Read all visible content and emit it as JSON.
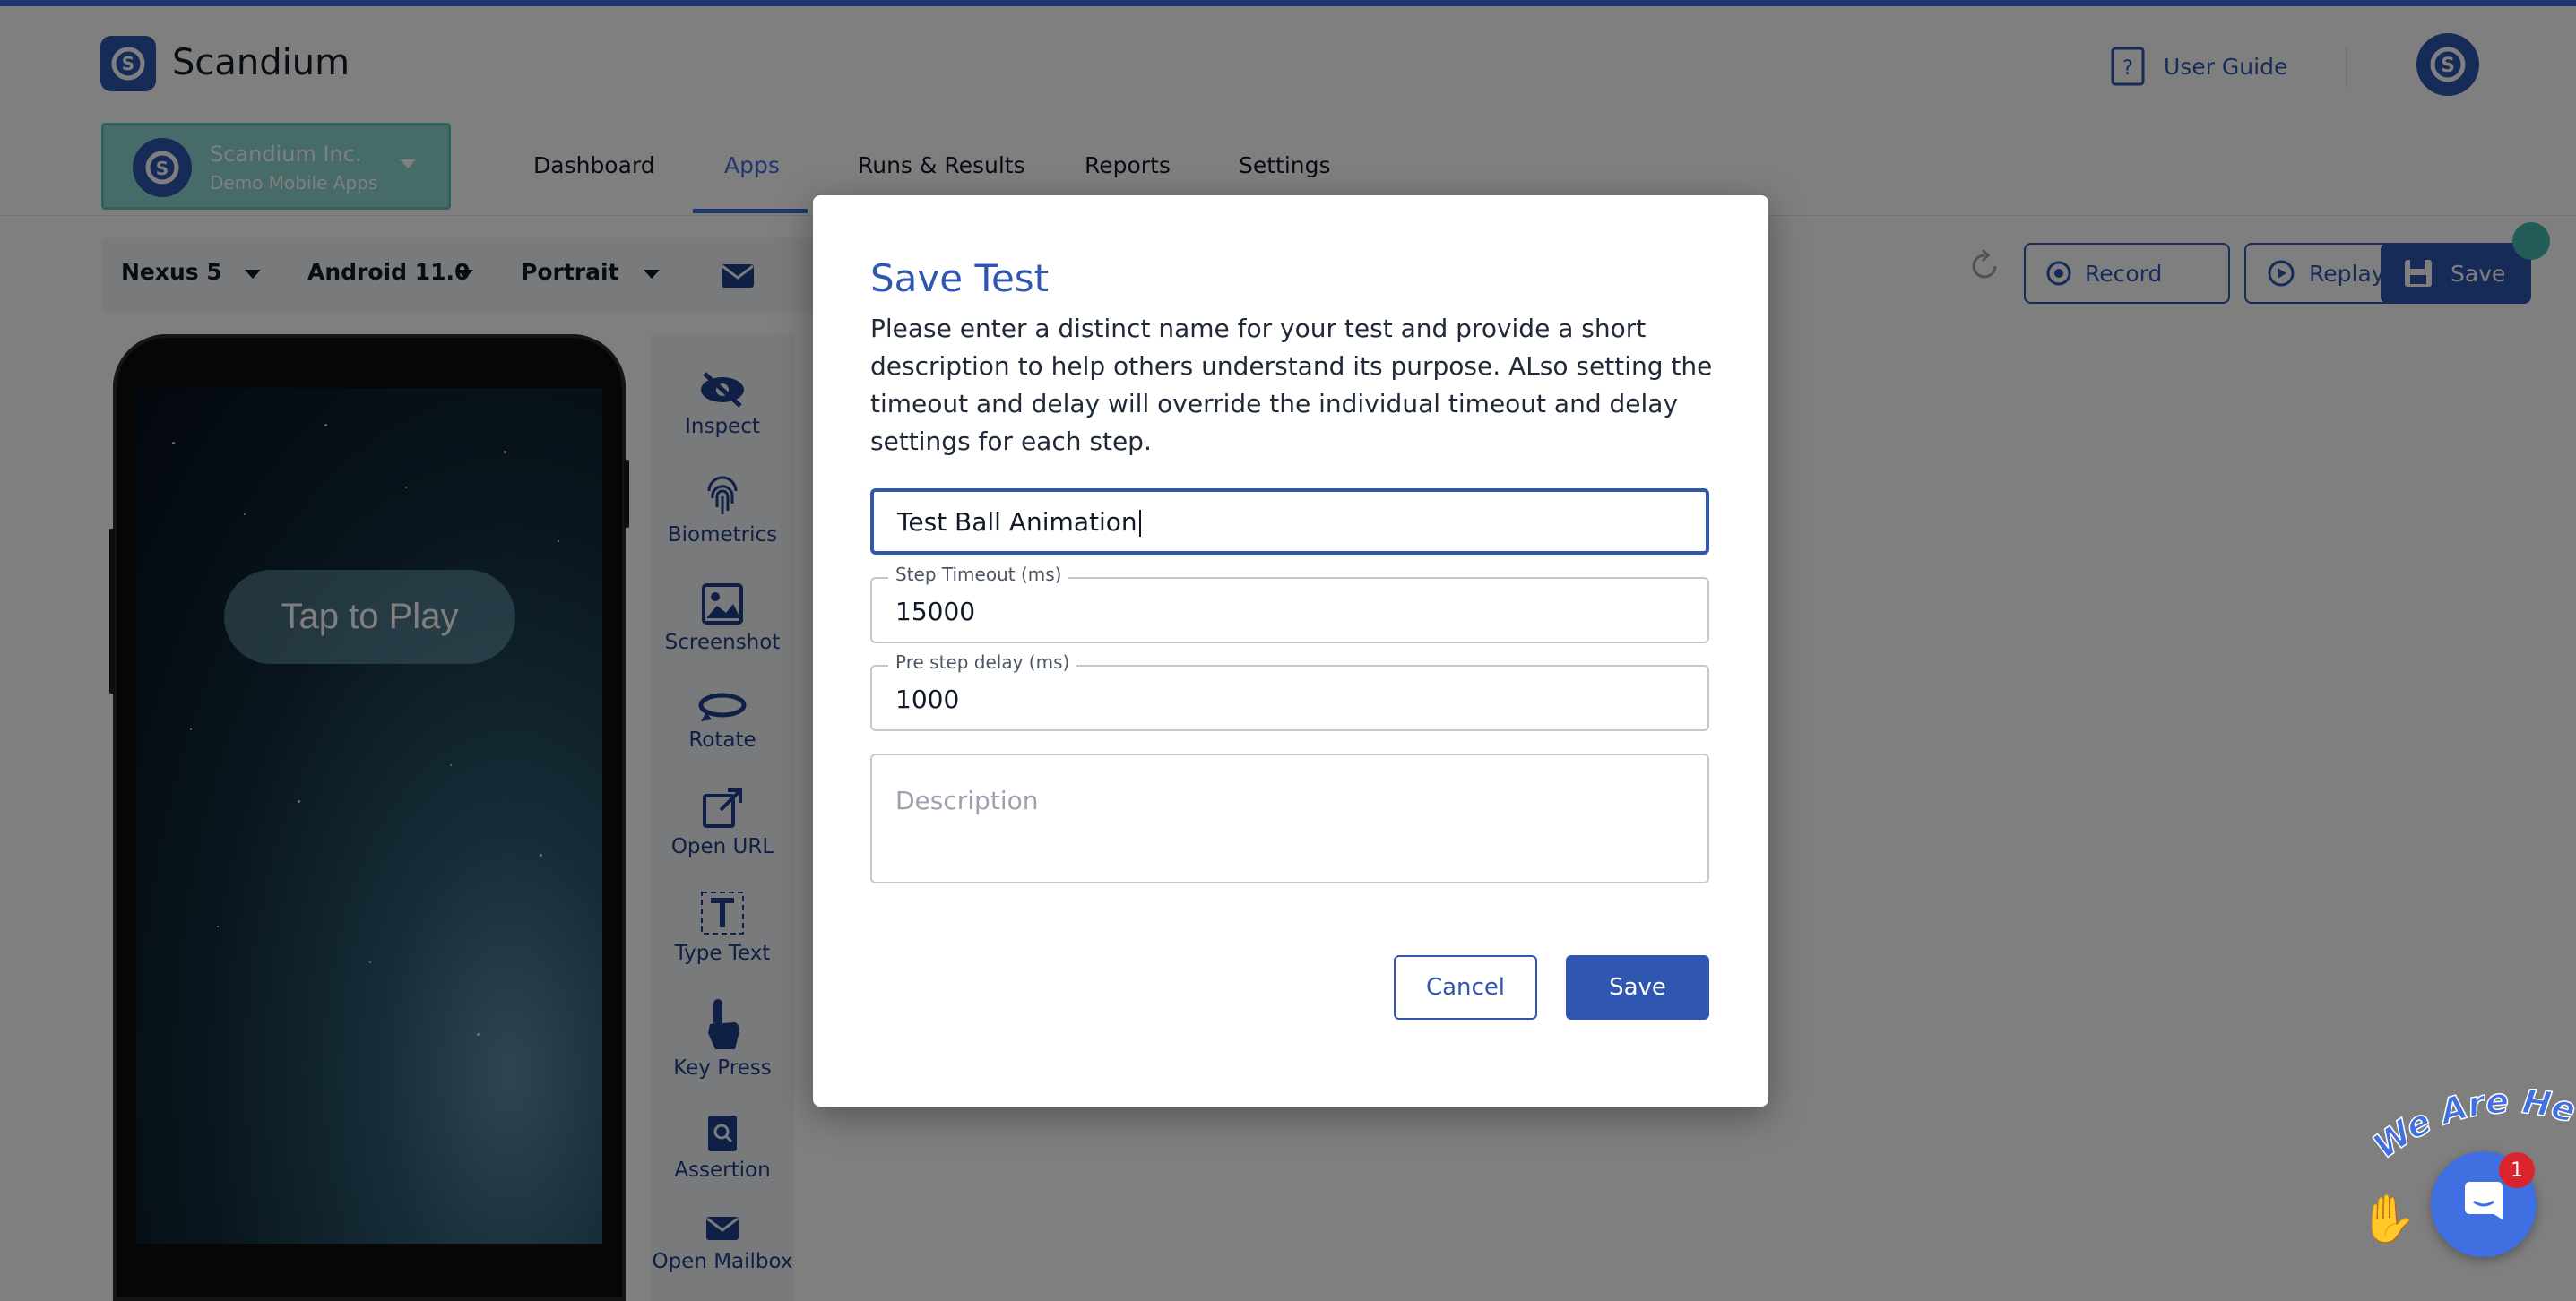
{
  "app": {
    "title": "Scandium"
  },
  "header": {
    "user_guide_label": "User Guide"
  },
  "org": {
    "name": "Scandium Inc.",
    "project": "Demo Mobile Apps"
  },
  "nav": {
    "tabs": [
      {
        "label": "Dashboard",
        "active": false
      },
      {
        "label": "Apps",
        "active": true
      },
      {
        "label": "Runs & Results",
        "active": false
      },
      {
        "label": "Reports",
        "active": false
      },
      {
        "label": "Settings",
        "active": false
      }
    ]
  },
  "toolbar": {
    "device": "Nexus 5",
    "os": "Android 11.0",
    "orientation": "Portrait",
    "record_label": "Record",
    "replay_label": "Replay",
    "save_label": "Save"
  },
  "device_screen": {
    "play_label": "Tap to Play"
  },
  "tools": [
    {
      "label": "Inspect",
      "icon": "eye-slash-icon"
    },
    {
      "label": "Biometrics",
      "icon": "fingerprint-icon"
    },
    {
      "label": "Screenshot",
      "icon": "image-icon"
    },
    {
      "label": "Rotate",
      "icon": "rotate-icon"
    },
    {
      "label": "Open URL",
      "icon": "external-link-icon"
    },
    {
      "label": "Type Text",
      "icon": "text-cursor-icon"
    },
    {
      "label": "Key Press",
      "icon": "pointer-hand-icon"
    },
    {
      "label": "Assertion",
      "icon": "search-doc-icon"
    },
    {
      "label": "Open Mailbox",
      "icon": "mail-icon"
    }
  ],
  "modal": {
    "title": "Save Test",
    "description": "Please enter a distinct name for your test and provide a short description to help others understand its purpose. ALso setting the timeout and delay will override the individual timeout and delay settings for each step.",
    "name_value": "Test Ball Animation",
    "step_timeout_label": "Step Timeout (ms)",
    "step_timeout_value": "15000",
    "pre_step_delay_label": "Pre step delay (ms)",
    "pre_step_delay_value": "1000",
    "description_placeholder": "Description",
    "cancel_label": "Cancel",
    "save_label": "Save"
  },
  "chat": {
    "banner": "We Are Here!",
    "badge_count": "1"
  },
  "colors": {
    "primary": "#2f56b0",
    "accent": "#3f6fe0",
    "teal": "#5fc4bd",
    "badge": "#d9232d"
  }
}
